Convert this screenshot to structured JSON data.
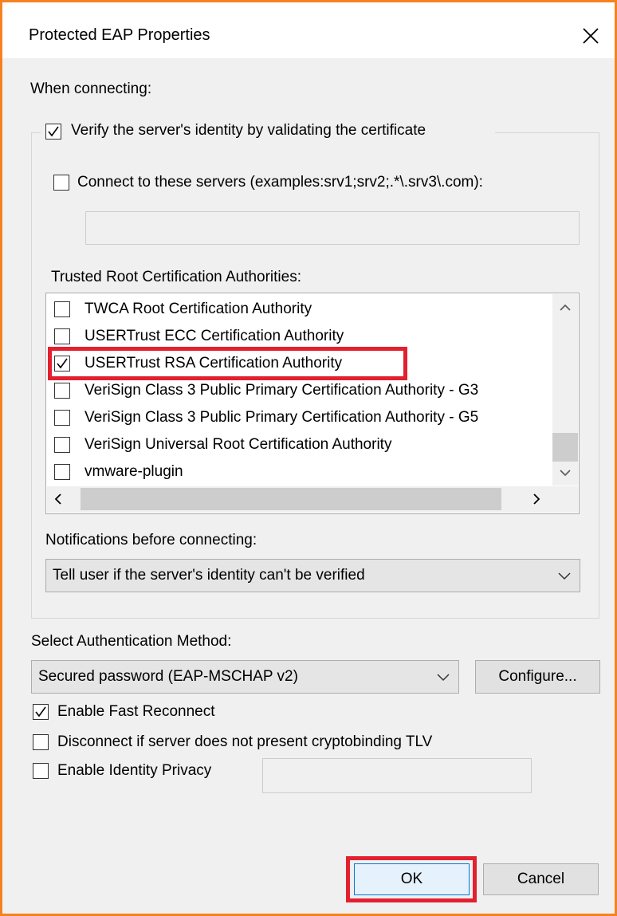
{
  "dialog": {
    "title": "Protected EAP Properties",
    "when_connecting": "When connecting:",
    "verify_server": {
      "label": "Verify the server's identity by validating the certificate",
      "checked": true
    },
    "connect_servers": {
      "label": "Connect to these servers (examples:srv1;srv2;.*\\.srv3\\.com):",
      "checked": false,
      "value": ""
    },
    "trusted_root_label": "Trusted Root Certification Authorities:",
    "cert_list": [
      {
        "label": "TWCA Root Certification Authority",
        "checked": false
      },
      {
        "label": "USERTrust ECC Certification Authority",
        "checked": false
      },
      {
        "label": "USERTrust RSA Certification Authority",
        "checked": true
      },
      {
        "label": "VeriSign Class 3 Public Primary Certification Authority - G3",
        "checked": false
      },
      {
        "label": "VeriSign Class 3 Public Primary Certification Authority - G5",
        "checked": false
      },
      {
        "label": "VeriSign Universal Root Certification Authority",
        "checked": false
      },
      {
        "label": "vmware-plugin",
        "checked": false
      }
    ],
    "notifications_label": "Notifications before connecting:",
    "notifications_value": "Tell user if the server's identity can't be verified",
    "auth_method_label": "Select Authentication Method:",
    "auth_method_value": "Secured password (EAP-MSCHAP v2)",
    "configure_label": "Configure...",
    "fast_reconnect": {
      "label": "Enable Fast Reconnect",
      "checked": true
    },
    "disconnect_tlv": {
      "label": "Disconnect if server does not present cryptobinding TLV",
      "checked": false
    },
    "identity_privacy": {
      "label": "Enable Identity Privacy",
      "checked": false,
      "value": ""
    },
    "ok_label": "OK",
    "cancel_label": "Cancel"
  },
  "colors": {
    "frame": "#f58220",
    "highlight": "#e3202f"
  }
}
